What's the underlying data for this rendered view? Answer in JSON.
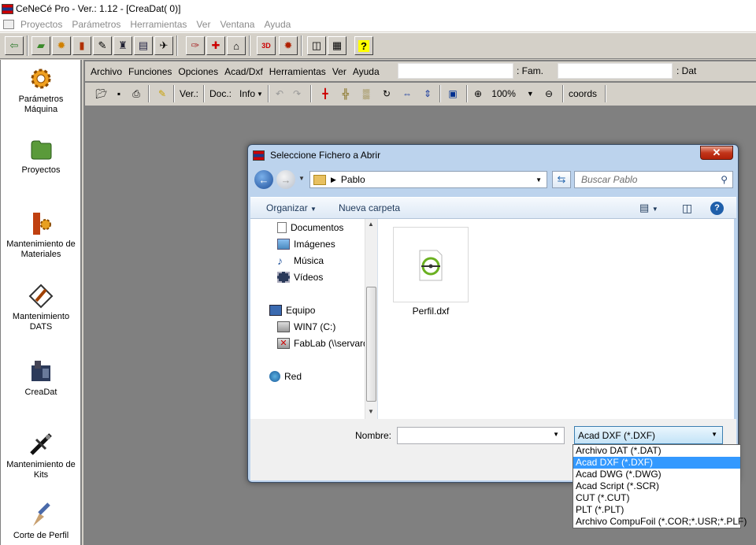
{
  "app": {
    "title": "CeNeCé Pro - Ver.: 1.12 - [CreaDat( 0)]"
  },
  "menubar": [
    "Proyectos",
    "Parámetros",
    "Herramientas",
    "Ver",
    "Ventana",
    "Ayuda"
  ],
  "sidebar": [
    {
      "label": "Parámetros\nMáquina",
      "icon": "gear-icon"
    },
    {
      "label": "Proyectos",
      "icon": "folder-icon"
    },
    {
      "label": "Mantenimiento de\nMateriales",
      "icon": "materials-icon"
    },
    {
      "label": "Mantenimiento\nDATS",
      "icon": "pencil-diamond-icon"
    },
    {
      "label": "CreaDat",
      "icon": "creadat-icon"
    },
    {
      "label": "Mantenimiento de\nKits",
      "icon": "kits-icon"
    },
    {
      "label": "Corte de Perfil",
      "icon": "cutter-icon"
    }
  ],
  "child": {
    "menu": [
      "Archivo",
      "Funciones",
      "Opciones",
      "Acad/Dxf",
      "Herramientas",
      "Ver",
      "Ayuda"
    ],
    "fam_label": ": Fam.",
    "dat_label": ": Dat",
    "ver_label": "Ver.:",
    "doc_label": "Doc.:",
    "info_label": "Info",
    "zoom": "100%",
    "coords_label": "coords"
  },
  "dialog": {
    "title": "Seleccione Fichero a Abrir",
    "path": "Pablo",
    "search_placeholder": "Buscar Pablo",
    "organize": "Organizar",
    "new_folder": "Nueva carpeta",
    "nav": [
      {
        "label": "Documentos",
        "icon": "documents-icon"
      },
      {
        "label": "Imágenes",
        "icon": "pictures-icon"
      },
      {
        "label": "Música",
        "icon": "music-icon"
      },
      {
        "label": "Vídeos",
        "icon": "videos-icon"
      },
      {
        "label": "Equipo",
        "icon": "computer-icon"
      },
      {
        "label": "WIN7 (C:)",
        "icon": "drive-icon"
      },
      {
        "label": "FabLab (\\\\servard",
        "icon": "network-drive-icon"
      },
      {
        "label": "Red",
        "icon": "network-icon"
      }
    ],
    "file": {
      "name": "Perfil.dxf",
      "icon": "dxf-file-icon"
    },
    "name_label": "Nombre:",
    "name_value": "",
    "filetype_selected": "Acad DXF (*.DXF)",
    "filetype_options": [
      "Archivo DAT (*.DAT)",
      "Acad DXF (*.DXF)",
      "Acad DWG (*.DWG)",
      "Acad Script (*.SCR)",
      "CUT (*.CUT)",
      "PLT (*.PLT)",
      "Archivo CompuFoil (*.COR;*.USR;*.PLF)"
    ],
    "filetype_highlighted": "Acad DXF (*.DXF)"
  }
}
